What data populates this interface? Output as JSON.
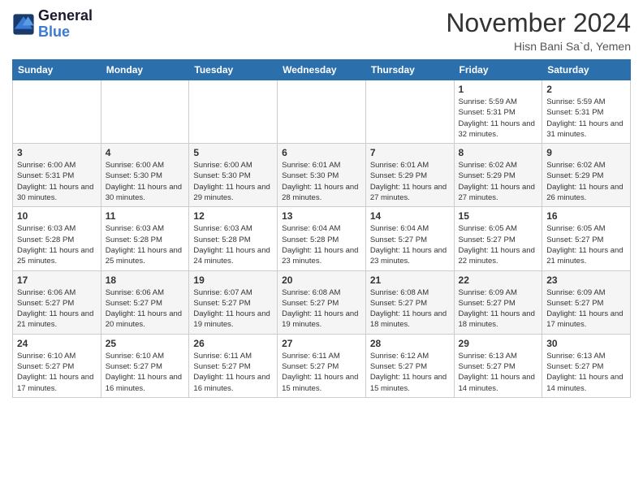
{
  "header": {
    "logo_line1": "General",
    "logo_line2": "Blue",
    "month_title": "November 2024",
    "location": "Hisn Bani Sa`d, Yemen"
  },
  "weekdays": [
    "Sunday",
    "Monday",
    "Tuesday",
    "Wednesday",
    "Thursday",
    "Friday",
    "Saturday"
  ],
  "weeks": [
    [
      {
        "day": "",
        "info": ""
      },
      {
        "day": "",
        "info": ""
      },
      {
        "day": "",
        "info": ""
      },
      {
        "day": "",
        "info": ""
      },
      {
        "day": "",
        "info": ""
      },
      {
        "day": "1",
        "info": "Sunrise: 5:59 AM\nSunset: 5:31 PM\nDaylight: 11 hours and 32 minutes."
      },
      {
        "day": "2",
        "info": "Sunrise: 5:59 AM\nSunset: 5:31 PM\nDaylight: 11 hours and 31 minutes."
      }
    ],
    [
      {
        "day": "3",
        "info": "Sunrise: 6:00 AM\nSunset: 5:31 PM\nDaylight: 11 hours and 30 minutes."
      },
      {
        "day": "4",
        "info": "Sunrise: 6:00 AM\nSunset: 5:30 PM\nDaylight: 11 hours and 30 minutes."
      },
      {
        "day": "5",
        "info": "Sunrise: 6:00 AM\nSunset: 5:30 PM\nDaylight: 11 hours and 29 minutes."
      },
      {
        "day": "6",
        "info": "Sunrise: 6:01 AM\nSunset: 5:30 PM\nDaylight: 11 hours and 28 minutes."
      },
      {
        "day": "7",
        "info": "Sunrise: 6:01 AM\nSunset: 5:29 PM\nDaylight: 11 hours and 27 minutes."
      },
      {
        "day": "8",
        "info": "Sunrise: 6:02 AM\nSunset: 5:29 PM\nDaylight: 11 hours and 27 minutes."
      },
      {
        "day": "9",
        "info": "Sunrise: 6:02 AM\nSunset: 5:29 PM\nDaylight: 11 hours and 26 minutes."
      }
    ],
    [
      {
        "day": "10",
        "info": "Sunrise: 6:03 AM\nSunset: 5:28 PM\nDaylight: 11 hours and 25 minutes."
      },
      {
        "day": "11",
        "info": "Sunrise: 6:03 AM\nSunset: 5:28 PM\nDaylight: 11 hours and 25 minutes."
      },
      {
        "day": "12",
        "info": "Sunrise: 6:03 AM\nSunset: 5:28 PM\nDaylight: 11 hours and 24 minutes."
      },
      {
        "day": "13",
        "info": "Sunrise: 6:04 AM\nSunset: 5:28 PM\nDaylight: 11 hours and 23 minutes."
      },
      {
        "day": "14",
        "info": "Sunrise: 6:04 AM\nSunset: 5:27 PM\nDaylight: 11 hours and 23 minutes."
      },
      {
        "day": "15",
        "info": "Sunrise: 6:05 AM\nSunset: 5:27 PM\nDaylight: 11 hours and 22 minutes."
      },
      {
        "day": "16",
        "info": "Sunrise: 6:05 AM\nSunset: 5:27 PM\nDaylight: 11 hours and 21 minutes."
      }
    ],
    [
      {
        "day": "17",
        "info": "Sunrise: 6:06 AM\nSunset: 5:27 PM\nDaylight: 11 hours and 21 minutes."
      },
      {
        "day": "18",
        "info": "Sunrise: 6:06 AM\nSunset: 5:27 PM\nDaylight: 11 hours and 20 minutes."
      },
      {
        "day": "19",
        "info": "Sunrise: 6:07 AM\nSunset: 5:27 PM\nDaylight: 11 hours and 19 minutes."
      },
      {
        "day": "20",
        "info": "Sunrise: 6:08 AM\nSunset: 5:27 PM\nDaylight: 11 hours and 19 minutes."
      },
      {
        "day": "21",
        "info": "Sunrise: 6:08 AM\nSunset: 5:27 PM\nDaylight: 11 hours and 18 minutes."
      },
      {
        "day": "22",
        "info": "Sunrise: 6:09 AM\nSunset: 5:27 PM\nDaylight: 11 hours and 18 minutes."
      },
      {
        "day": "23",
        "info": "Sunrise: 6:09 AM\nSunset: 5:27 PM\nDaylight: 11 hours and 17 minutes."
      }
    ],
    [
      {
        "day": "24",
        "info": "Sunrise: 6:10 AM\nSunset: 5:27 PM\nDaylight: 11 hours and 17 minutes."
      },
      {
        "day": "25",
        "info": "Sunrise: 6:10 AM\nSunset: 5:27 PM\nDaylight: 11 hours and 16 minutes."
      },
      {
        "day": "26",
        "info": "Sunrise: 6:11 AM\nSunset: 5:27 PM\nDaylight: 11 hours and 16 minutes."
      },
      {
        "day": "27",
        "info": "Sunrise: 6:11 AM\nSunset: 5:27 PM\nDaylight: 11 hours and 15 minutes."
      },
      {
        "day": "28",
        "info": "Sunrise: 6:12 AM\nSunset: 5:27 PM\nDaylight: 11 hours and 15 minutes."
      },
      {
        "day": "29",
        "info": "Sunrise: 6:13 AM\nSunset: 5:27 PM\nDaylight: 11 hours and 14 minutes."
      },
      {
        "day": "30",
        "info": "Sunrise: 6:13 AM\nSunset: 5:27 PM\nDaylight: 11 hours and 14 minutes."
      }
    ]
  ]
}
